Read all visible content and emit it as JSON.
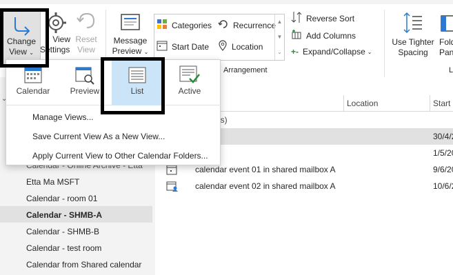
{
  "ribbon": {
    "change_view": {
      "line1": "Change",
      "line2": "View"
    },
    "view_settings": {
      "line1": "View",
      "line2": "Settings"
    },
    "reset_view": {
      "line1": "Reset",
      "line2": "View"
    },
    "message_preview": {
      "line1": "Message",
      "line2": "Preview"
    },
    "arrangement": {
      "categories": "Categories",
      "recurrence": "Recurrence",
      "start_date": "Start Date",
      "location": "Location",
      "reverse_sort": "Reverse Sort",
      "add_columns": "Add Columns",
      "expand_collapse": "Expand/Collapse",
      "group_label": "Arrangement"
    },
    "layout": {
      "tighter_spacing": {
        "line1": "Use Tighter",
        "line2": "Spacing"
      },
      "folder_pane": {
        "line1": "Folde",
        "line2": "Pane"
      },
      "group_label": "L"
    }
  },
  "dropdown": {
    "tiles": [
      {
        "label": "Calendar",
        "icon": "calendar-view-icon",
        "selected": false
      },
      {
        "label": "Preview",
        "icon": "preview-view-icon",
        "selected": false
      },
      {
        "label": "List",
        "icon": "list-view-icon",
        "selected": true
      },
      {
        "label": "Active",
        "icon": "active-view-icon",
        "selected": false
      }
    ],
    "menu": [
      {
        "label": "Manage Views..."
      },
      {
        "label": "Save Current View As a New View..."
      },
      {
        "label": "Apply Current View to Other Calendar Folders..."
      }
    ]
  },
  "sidebar": {
    "partial_item": "Calendar - Online Archive - Etta",
    "items": [
      {
        "label": "Etta Ma MSFT",
        "bold": false
      },
      {
        "label": "Calendar - room 01",
        "bold": false
      },
      {
        "label": "Calendar - SHMB-A",
        "bold": true
      },
      {
        "label": "Calendar - SHMB-B",
        "bold": false
      },
      {
        "label": "Calendar - test room",
        "bold": false
      },
      {
        "label": "Calendar from Shared calendar",
        "bold": false
      }
    ]
  },
  "list": {
    "columns": {
      "subject_tail": "t",
      "location": "Location",
      "start": "Start"
    },
    "group_header": "n(s)",
    "rows": [
      {
        "subject": "",
        "location": "",
        "start": "30/4/2"
      },
      {
        "subject": "",
        "location": "",
        "start": "1/5/20"
      },
      {
        "subject": "calendar event 01 in shared mailbox A",
        "location": "",
        "start": "9/6/20"
      },
      {
        "subject": "calendar event 02 in shared mailbox A",
        "location": "",
        "start": "10/6/2"
      }
    ]
  },
  "colors": {
    "accent": "#2b79d0",
    "selected_tile": "#cce4f7",
    "sidebar_bg": "#f3f3f3",
    "highlight_box": "#000000"
  }
}
